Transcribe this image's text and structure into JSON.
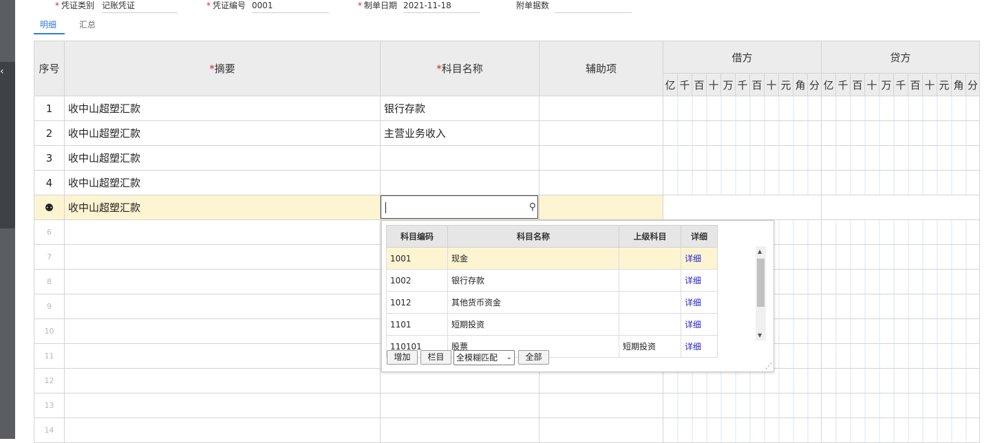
{
  "header": {
    "voucher_type_label": "凭证类别",
    "voucher_type_value": "记账凭证",
    "voucher_no_label": "凭证编号",
    "voucher_no_value": "0001",
    "date_label": "制单日期",
    "date_value": "2021-11-18",
    "attachments_label": "附单据数",
    "attachments_value": ""
  },
  "tabs": {
    "detail": "明细",
    "summary": "汇总"
  },
  "grid": {
    "col_seq": "序号",
    "col_summary": "摘要",
    "col_account": "科目名称",
    "col_aux": "辅助项",
    "col_debit": "借方",
    "col_credit": "贷方",
    "digits": [
      "亿",
      "千",
      "百",
      "十",
      "万",
      "千",
      "百",
      "十",
      "元",
      "角",
      "分"
    ],
    "rows": [
      {
        "seq": "1",
        "summary": "收中山超塑汇款",
        "account": "银行存款"
      },
      {
        "seq": "2",
        "summary": "收中山超塑汇款",
        "account": "主营业务收入"
      },
      {
        "seq": "3",
        "summary": "收中山超塑汇款",
        "account": ""
      },
      {
        "seq": "4",
        "summary": "收中山超塑汇款",
        "account": ""
      },
      {
        "seq": "",
        "summary": "收中山超塑汇款",
        "account": ""
      },
      {
        "seq": "6",
        "summary": "",
        "account": ""
      },
      {
        "seq": "7",
        "summary": "",
        "account": ""
      },
      {
        "seq": "8",
        "summary": "",
        "account": ""
      },
      {
        "seq": "9",
        "summary": "",
        "account": ""
      },
      {
        "seq": "10",
        "summary": "",
        "account": ""
      },
      {
        "seq": "11",
        "summary": "",
        "account": ""
      },
      {
        "seq": "12",
        "summary": "",
        "account": ""
      },
      {
        "seq": "13",
        "summary": "",
        "account": ""
      },
      {
        "seq": "14",
        "summary": "",
        "account": ""
      }
    ]
  },
  "popup": {
    "col_code": "科目编码",
    "col_name": "科目名称",
    "col_parent": "上级科目",
    "col_detail": "详细",
    "rows": [
      {
        "code": "1001",
        "name": "现金",
        "parent": "",
        "detail": "详细"
      },
      {
        "code": "1002",
        "name": "银行存款",
        "parent": "",
        "detail": "详细"
      },
      {
        "code": "1012",
        "name": "其他货币资金",
        "parent": "",
        "detail": "详细"
      },
      {
        "code": "1101",
        "name": "短期投资",
        "parent": "",
        "detail": "详细"
      },
      {
        "code": "110101",
        "name": "股票",
        "parent": "短期投资",
        "detail": "详细"
      }
    ],
    "btn_add": "增加",
    "btn_columns": "栏目",
    "match_mode": "全模糊匹配",
    "btn_all": "全部"
  },
  "colors": {
    "accent": "#2d7be0",
    "highlight_row": "#fdf4d2",
    "required": "#e02020"
  }
}
